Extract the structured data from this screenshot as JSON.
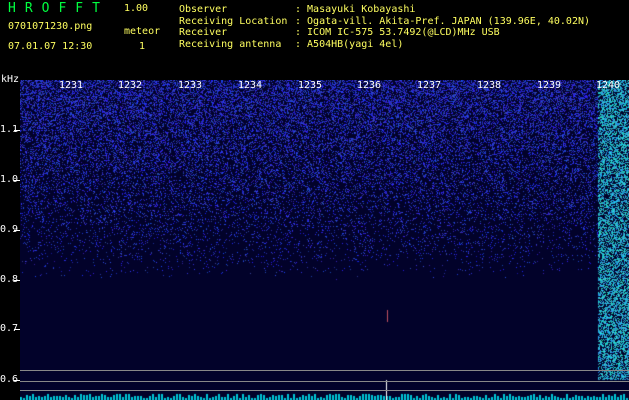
{
  "header": {
    "app_name": "HROFFT",
    "version": "1.00",
    "filename": "0701071230.png",
    "datetime": "07.01.07 12:30",
    "meteor_label": "meteor",
    "meteor_count": "1",
    "info": [
      {
        "key": "Observer",
        "value": ": Masayuki Kobayashi"
      },
      {
        "key": "Receiving Location",
        "value": ": Ogata-vill. Akita-Pref. JAPAN (139.96E, 40.02N)"
      },
      {
        "key": "Receiver",
        "value": ": ICOM IC-575 53.7492(@LCD)MHz USB"
      },
      {
        "key": "Receiving antenna",
        "value": ": A504HB(yagi 4el)"
      }
    ]
  },
  "spectrogram": {
    "y_unit": "kHz",
    "y_ticks": [
      "1.1",
      "1.0",
      "0.9",
      "0.8",
      "0.7",
      "0.6"
    ],
    "x_ticks": [
      "1231",
      "1232",
      "1233",
      "1234",
      "1235",
      "1236",
      "1237",
      "1238",
      "1239",
      "1240"
    ],
    "colors": {
      "background": "#02022a",
      "noise": "#2a2aff",
      "hot": "#00d0e0"
    }
  }
}
